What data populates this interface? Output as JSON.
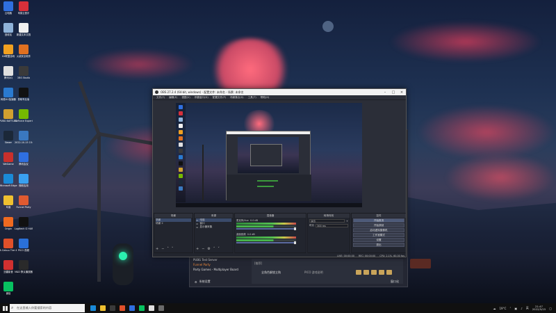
{
  "desktop": {
    "icons": [
      {
        "label": "云电脑",
        "color": "#2f6fe0"
      },
      {
        "label": "网易云音乐",
        "color": "#d6303a"
      },
      {
        "label": "回收站",
        "color": "#8fb3d9"
      },
      {
        "label": "新建文本文档",
        "color": "#f0f0f0"
      },
      {
        "label": "XX联盟游戏",
        "color": "#f0a020"
      },
      {
        "label": "火绒安全软件",
        "color": "#e07020"
      },
      {
        "label": "腾讯QQ",
        "color": "#e0e0e0"
      },
      {
        "label": "OBS Studio",
        "color": "#3a3a3a"
      },
      {
        "label": "网易UU加速器",
        "color": "#2a7ad0"
      },
      {
        "label": "剪映专业版",
        "color": "#111111"
      },
      {
        "label": "PUBG BATTLEGR",
        "color": "#d0a030"
      },
      {
        "label": "GeForce Experience",
        "color": "#76b900"
      },
      {
        "label": "Steam",
        "color": "#1b2838"
      },
      {
        "label": "2022-10-15 15:56",
        "color": "#3a78c0"
      },
      {
        "label": "WeGame",
        "color": "#c9302c"
      },
      {
        "label": "腾讯会议",
        "color": "#2f6fe0"
      },
      {
        "label": "Microsoft Edge",
        "color": "#1a8ad8"
      },
      {
        "label": "微软应用",
        "color": "#3aa0f0"
      },
      {
        "label": "叫谱",
        "color": "#f0c030"
      },
      {
        "label": "Funnel Party",
        "color": "#e05a30"
      },
      {
        "label": "Origin",
        "color": "#f06a20"
      },
      {
        "label": "Logitech G HUB",
        "color": "#111111"
      },
      {
        "label": "A Cebuu Tire 4",
        "color": "#e0502a"
      },
      {
        "label": "PICO 视频",
        "color": "#2a70d8"
      },
      {
        "label": "迅雷影音",
        "color": "#d03030"
      },
      {
        "label": "N&D 默认播放器",
        "color": "#2a2a2a"
      },
      {
        "label": "微信",
        "color": "#07c160"
      }
    ]
  },
  "obs": {
    "title": "OBS 27.2.4 (64-bit, windows) - 配置文件: 未命名 - 场景: 未命名",
    "menu": [
      "文件(F)",
      "编辑(E)",
      "视图(V)",
      "停靠窗口(D)",
      "配置文件(P)",
      "场景集合(S)",
      "工具(T)",
      "帮助(H)"
    ],
    "panels": {
      "scenes": {
        "title": "场景",
        "items": [
          "场景",
          "场景 2"
        ]
      },
      "sources": {
        "title": "来源",
        "items": [
          "电脑",
          "窗口",
          "显示器采集"
        ]
      },
      "mixer": {
        "title": "混音器",
        "channels": [
          {
            "name": "麦克风/Aux",
            "db": "0.0 dB"
          },
          {
            "name": "桌面音频",
            "db": "0.0 dB"
          }
        ]
      },
      "transitions": {
        "title": "转场特效",
        "type_label": "淡出",
        "duration_label": "时长",
        "duration_value": "300 ms"
      },
      "controls": {
        "title": "控件",
        "buttons": [
          "开始推流",
          "开始录制",
          "启动虚拟摄像机",
          "工作室模式",
          "设置",
          "退出"
        ]
      }
    },
    "status": {
      "live": "LIVE: 00:00:00",
      "rec": "REC: 00:00:00",
      "cpu": "CPU: 2.1%, 60.00 fps"
    }
  },
  "launcher": {
    "list": [
      "PUBG Test Server",
      "Funnel Party",
      "Party Games - Multiplayer Board"
    ],
    "content_title": "[推荐]",
    "content_item": "全角色解锁立购",
    "content_hint": "PICO 游戏说明",
    "settings_label": "系统设置",
    "window_label": "窗口化"
  },
  "taskbar": {
    "search_placeholder": "在这里输入你要搜索的内容",
    "app_colors": [
      "#1a8ad8",
      "#f0c030",
      "#3a3a3a",
      "#e0502a",
      "#2f6fe0",
      "#07c160",
      "#e0e0e0",
      "#6a6a6a"
    ],
    "temperature": "19°C",
    "ime": "英",
    "time": "21:47",
    "date": "2022/5/15"
  }
}
